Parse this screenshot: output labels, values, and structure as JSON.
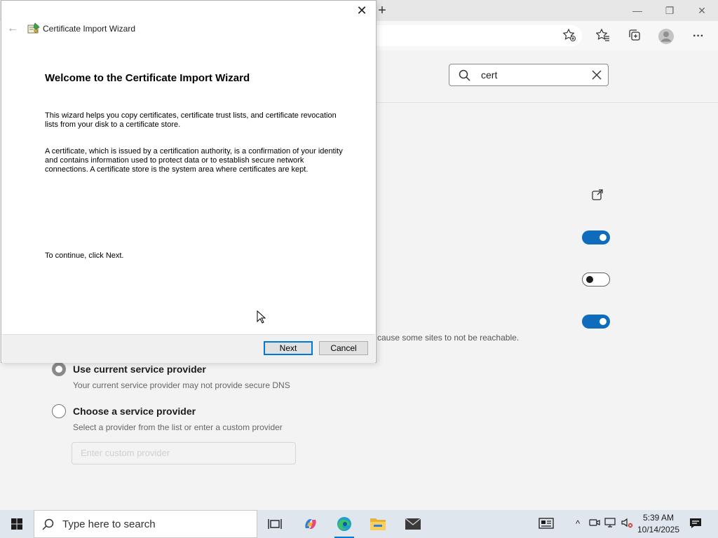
{
  "browser": {
    "new_tab": "+",
    "window_controls": {
      "minimize": "—",
      "restore": "❐",
      "close": "✕"
    },
    "toolbar_icons": [
      "favorites-add-icon",
      "favorites-icon",
      "collections-icon",
      "profile-icon",
      "more-icon"
    ],
    "more_label": "···"
  },
  "settings": {
    "search": {
      "value": "cert"
    },
    "dns_note": "cause some sites to not be reachable.",
    "toggles": [
      {
        "state": "on"
      },
      {
        "state": "off"
      },
      {
        "state": "on"
      }
    ],
    "options": [
      {
        "label": "Use current service provider",
        "desc": "Your current service provider may not provide secure DNS",
        "checked": true
      },
      {
        "label": "Choose a service provider",
        "desc": "Select a provider from the list or enter a custom provider",
        "checked": false
      }
    ],
    "provider_input": {
      "placeholder": "Enter custom provider"
    }
  },
  "wizard": {
    "title": "Certificate Import Wizard",
    "close": "✕",
    "back": "←",
    "heading": "Welcome to the Certificate Import Wizard",
    "para1": "This wizard helps you copy certificates, certificate trust lists, and certificate revocation lists from your disk to a certificate store.",
    "para2": "A certificate, which is issued by a certification authority, is a confirmation of your identity and contains information used to protect data or to establish secure network connections. A certificate store is the system area where certificates are kept.",
    "para3": "To continue, click Next.",
    "next_label": "Next",
    "cancel_label": "Cancel"
  },
  "taskbar": {
    "search_placeholder": "Type here to search",
    "time": "5:39 AM",
    "date": "10/14/2025",
    "tray_chevron": "^",
    "apps": [
      "task-view",
      "copilot",
      "edge",
      "file-explorer",
      "mail"
    ]
  },
  "colors": {
    "accent": "#0f6cbd",
    "taskbar": "#dfe6ee",
    "wizard_primary_border": "#0078d7"
  }
}
